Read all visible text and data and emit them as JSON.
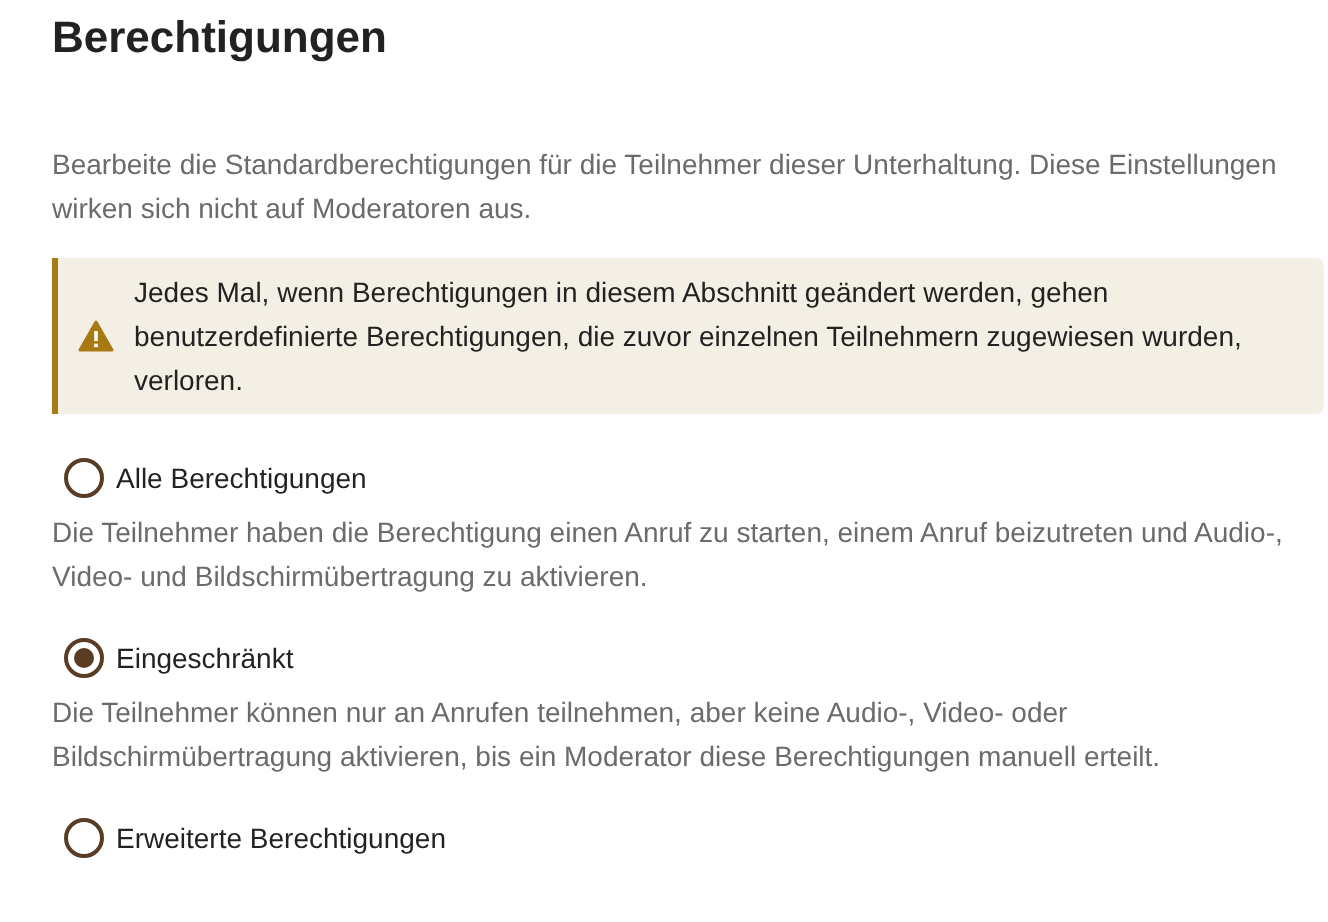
{
  "title": "Berechtigungen",
  "description": "Bearbeite die Standardberechtigungen für die Teilnehmer dieser Unterhaltung. Diese Einstellungen wirken sich nicht auf Moderatoren aus.",
  "warning": {
    "text": "Jedes Mal, wenn Berechtigungen in diesem Abschnitt geändert werden, gehen benutzerdefinierte Berechtigungen, die zuvor einzelnen Teilnehmern zugewiesen wurden, verloren."
  },
  "options": [
    {
      "label": "Alle Berechtigungen",
      "selected": false,
      "description": "Die Teilnehmer haben die Berechtigung einen Anruf zu starten, einem Anruf beizutreten und Audio-, Video- und Bildschirmübertragung zu aktivieren."
    },
    {
      "label": "Eingeschränkt",
      "selected": true,
      "description": "Die Teilnehmer können nur an Anrufen teilnehmen, aber keine Audio-, Video- oder Bildschirmübertragung aktivieren, bis ein Moderator diese Berechtigungen manuell erteilt."
    },
    {
      "label": "Erweiterte Berechtigungen",
      "selected": false
    }
  ]
}
